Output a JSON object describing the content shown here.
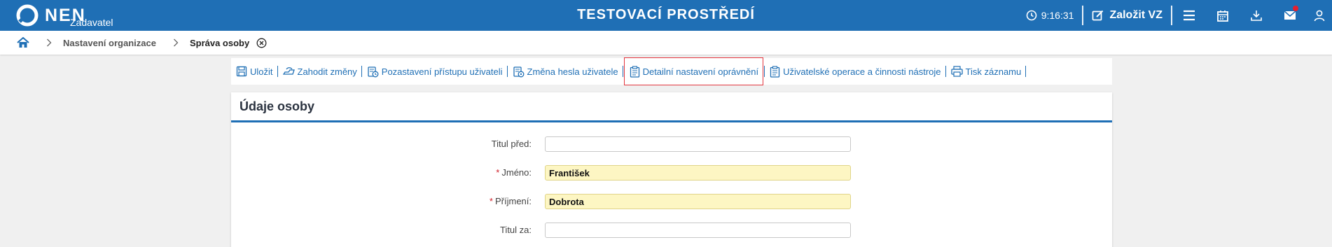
{
  "topbar": {
    "logo_text": "NEN",
    "logo_subtitle": "Zadavatel",
    "environment_title": "TESTOVACÍ PROSTŘEDÍ",
    "clock_time": "9:16:31",
    "create_button_label": "Založit VZ",
    "icons": [
      "clock-icon",
      "edit-icon",
      "menu-icon",
      "calendar-icon",
      "download-icon",
      "mail-icon",
      "user-icon"
    ],
    "notification_badge_color": "#e5202e"
  },
  "breadcrumb": {
    "items": [
      "Nastavení organizace"
    ],
    "current": "Správa osoby"
  },
  "toolbar": {
    "items": [
      {
        "label": "Uložit",
        "icon": "save-icon"
      },
      {
        "label": "Zahodit změny",
        "icon": "discard-icon"
      },
      {
        "label": "Pozastavení přístupu uživateli",
        "icon": "suspend-access-icon"
      },
      {
        "label": "Změna hesla uživatele",
        "icon": "password-change-icon"
      },
      {
        "label": "Detailní nastavení oprávnění",
        "icon": "permissions-icon"
      },
      {
        "label": "Uživatelské operace a činnosti nástroje",
        "icon": "operations-icon"
      },
      {
        "label": "Tisk záznamu",
        "icon": "print-icon"
      }
    ],
    "highlighted_item": "Detailní nastavení oprávnění",
    "highlight_color": "#e3343d"
  },
  "panel": {
    "title": "Údaje osoby",
    "fields": [
      {
        "label": "Titul před:",
        "value": "",
        "required": false
      },
      {
        "label": "Jméno:",
        "value": "František",
        "required": true
      },
      {
        "label": "Příjmení:",
        "value": "Dobrota",
        "required": true
      },
      {
        "label": "Titul za:",
        "value": "",
        "required": false
      }
    ]
  },
  "colors": {
    "brand_blue": "#1f6fb5",
    "required_field_bg": "#fdf6c3",
    "required_marker": "#d0212b"
  }
}
